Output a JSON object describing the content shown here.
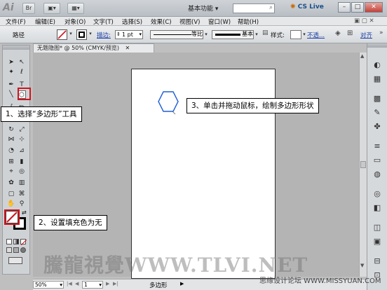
{
  "app": {
    "logo": "Ai",
    "title_buttons": [
      "Br",
      "▣▾",
      "▦▾"
    ],
    "workspace": "基本功能",
    "cs_live": "CS Live",
    "window_controls": [
      "–",
      "□",
      "✕"
    ]
  },
  "menubar": {
    "items": [
      "文件(F)",
      "编辑(E)",
      "对象(O)",
      "文字(T)",
      "选择(S)",
      "效果(C)",
      "视图(V)",
      "窗口(W)",
      "帮助(H)"
    ],
    "right": "▣ ▢ ✕"
  },
  "controlbar": {
    "object_label": "路径",
    "stroke_label": "描边:",
    "stroke_weight": "1 pt",
    "profile_label": "等比",
    "brush_label": "基本",
    "style_label": "样式:",
    "opacity_label": "不透...",
    "align_label": "对齐"
  },
  "document": {
    "tab_title": "无题隐图*",
    "tab_zoom": "@ 50% (CMYK/预览)",
    "tab_close": "✕"
  },
  "statusbar": {
    "zoom": "50%",
    "page": "1",
    "tool_name": "多边形"
  },
  "callouts": {
    "step1": "1、选择“多边形”工具",
    "step2": "2、设置填充色为无",
    "step3": "3、单击并拖动鼠标，绘制多边形形状"
  },
  "watermark": {
    "main": "騰龍視覺WWW.TLVI.NET",
    "sub": "思缘设计论坛 WWW.MISSYUAN.COM"
  },
  "colors": {
    "highlight_red": "#d0141c",
    "polygon_stroke": "#1f5fd6",
    "link_blue": "#1a3fa8"
  },
  "tools": [
    [
      "selection-tool-icon",
      "direct-selection-tool-icon"
    ],
    [
      "magic-wand-tool-icon",
      "lasso-tool-icon"
    ],
    [
      "pen-tool-icon",
      "type-tool-icon"
    ],
    [
      "line-tool-icon",
      "polygon-tool-icon"
    ],
    [
      "paintbrush-tool-icon",
      "pencil-tool-icon"
    ],
    [
      "blob-brush-tool-icon",
      "eraser-tool-icon"
    ],
    [
      "rotate-tool-icon",
      "scale-tool-icon"
    ],
    [
      "width-tool-icon",
      "free-transform-tool-icon"
    ],
    [
      "shape-builder-tool-icon",
      "perspective-grid-tool-icon"
    ],
    [
      "mesh-tool-icon",
      "gradient-tool-icon"
    ],
    [
      "eyedropper-tool-icon",
      "blend-tool-icon"
    ],
    [
      "symbol-sprayer-tool-icon",
      "column-graph-tool-icon"
    ],
    [
      "artboard-tool-icon",
      "slice-tool-icon"
    ],
    [
      "hand-tool-icon",
      "zoom-tool-icon"
    ]
  ]
}
